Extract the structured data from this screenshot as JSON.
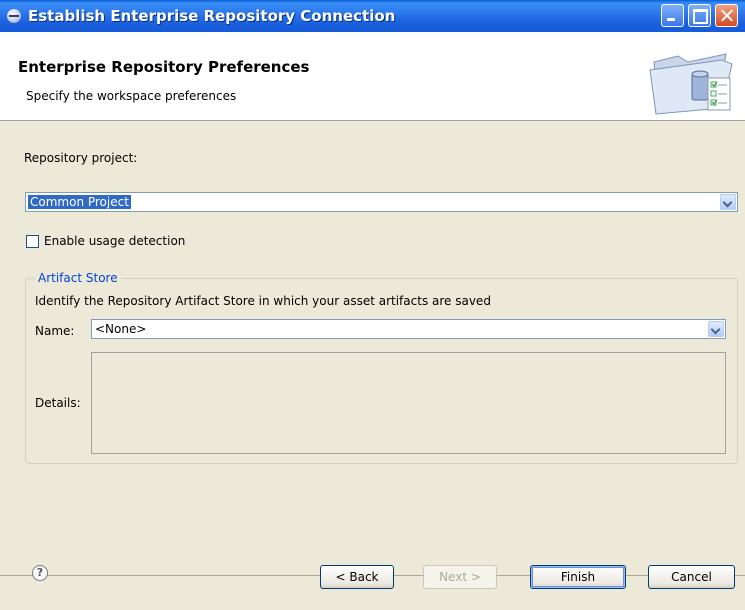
{
  "window": {
    "title": "Establish Enterprise Repository Connection",
    "controls": {
      "minimize": "minimize",
      "maximize": "maximize",
      "close": "close"
    }
  },
  "header": {
    "title": "Enterprise Repository Preferences",
    "subtitle": "Specify the workspace preferences",
    "art_icon": "folder-database-checklist-icon"
  },
  "form": {
    "repository_project_label": "Repository project:",
    "repository_project_value": "Common Project",
    "enable_usage_label": "Enable usage detection",
    "enable_usage_checked": false,
    "artifact_store": {
      "legend": "Artifact Store",
      "description": "Identify the Repository Artifact Store in which your asset artifacts are saved",
      "name_label": "Name:",
      "name_value": "<None>",
      "details_label": "Details:",
      "details_value": ""
    }
  },
  "footer": {
    "help_icon": "help-icon",
    "help_glyph": "?",
    "back_label": "< Back",
    "next_label": "Next >",
    "finish_label": "Finish",
    "cancel_label": "Cancel"
  },
  "colors": {
    "titlebar": "#2a74ea",
    "dialog_bg": "#ece9d8",
    "selection": "#316ac5",
    "legend_text": "#0046d5"
  }
}
